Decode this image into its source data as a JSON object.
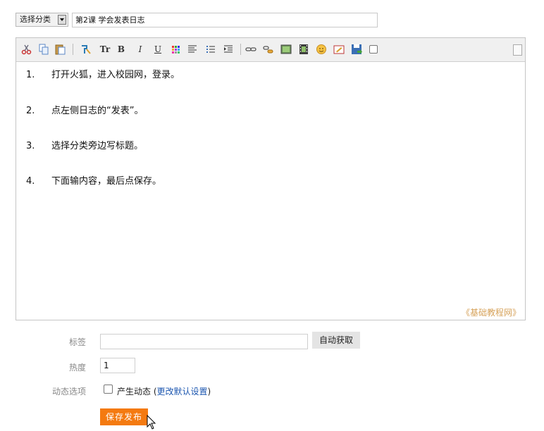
{
  "category_select": {
    "label": "选择分类"
  },
  "title_input": {
    "value": "第2课  学会发表日志"
  },
  "toolbar": {
    "icons": [
      "cut-icon",
      "copy-icon",
      "paste-icon",
      "format-paint-icon",
      "font-size-icon",
      "bold-icon",
      "italic-icon",
      "underline-icon",
      "color-icon",
      "align-icon",
      "unordered-list-icon",
      "indent-icon",
      "link-icon",
      "unlink-icon",
      "image-icon",
      "video-icon",
      "emoji-icon",
      "edit-source-icon",
      "save-icon"
    ],
    "bold": "B",
    "italic": "I",
    "underline": "U",
    "font_size": "Tr"
  },
  "content": {
    "items": [
      {
        "num": "1.",
        "text": "打开火狐，进入校园网，登录。"
      },
      {
        "num": "2.",
        "text": "点左侧日志的“发表”。"
      },
      {
        "num": "3.",
        "text": "选择分类旁边写标题。"
      },
      {
        "num": "4.",
        "text": "下面输内容，最后点保存。"
      }
    ],
    "watermark": "《基础教程网》"
  },
  "form": {
    "tags_label": "标签",
    "tags_value": "",
    "auto_fetch": "自动获取",
    "hot_label": "热度",
    "hot_value": "1",
    "dynamic_label": "动态选项",
    "dynamic_text": "产生动态",
    "dynamic_open": "(",
    "dynamic_link": "更改默认设置",
    "dynamic_close": ")",
    "save": "保存发布"
  },
  "colors": {
    "accent": "#f47a10",
    "link": "#1d57b0",
    "watermark": "#d6a25a"
  }
}
